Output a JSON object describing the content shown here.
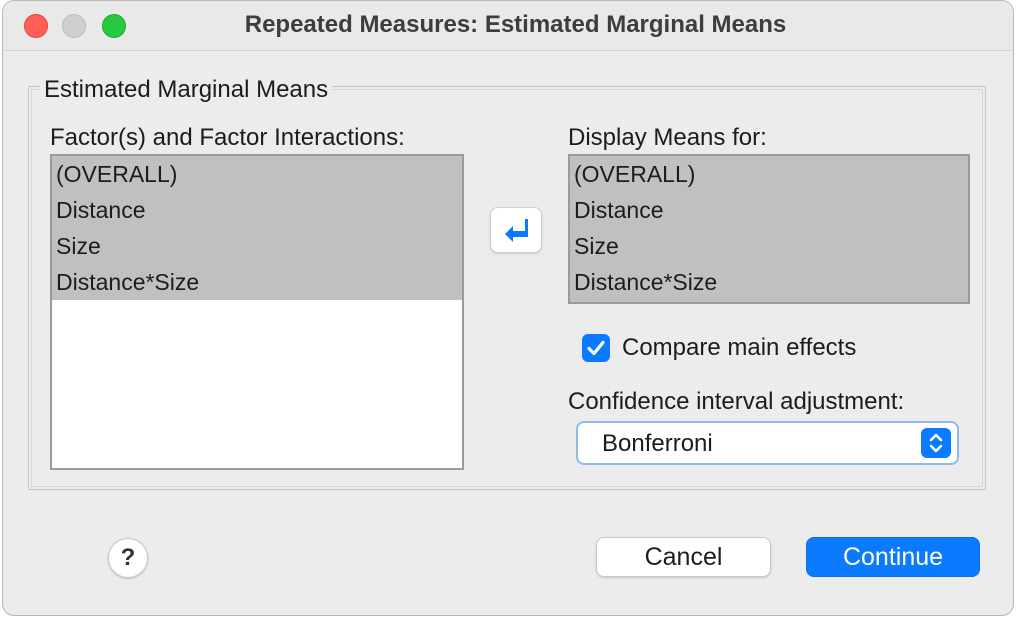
{
  "window": {
    "title": "Repeated Measures: Estimated Marginal Means"
  },
  "group": {
    "legend": "Estimated Marginal Means"
  },
  "factors": {
    "label": "Factor(s) and Factor Interactions:",
    "items": [
      "(OVERALL)",
      "Distance",
      "Size",
      "Distance*Size"
    ]
  },
  "display": {
    "label": "Display Means for:",
    "items": [
      "(OVERALL)",
      "Distance",
      "Size",
      "Distance*Size"
    ]
  },
  "move_button": {
    "icon": "arrow-left-icon"
  },
  "compare": {
    "label": "Compare main effects",
    "checked": true
  },
  "ci": {
    "label": "Confidence interval adjustment:",
    "selected": "Bonferroni"
  },
  "buttons": {
    "help": "?",
    "cancel": "Cancel",
    "continue": "Continue"
  },
  "colors": {
    "accent": "#0a7aff",
    "selection": "#c0c0c0",
    "close": "#ff5f57",
    "maximize": "#28c840"
  }
}
